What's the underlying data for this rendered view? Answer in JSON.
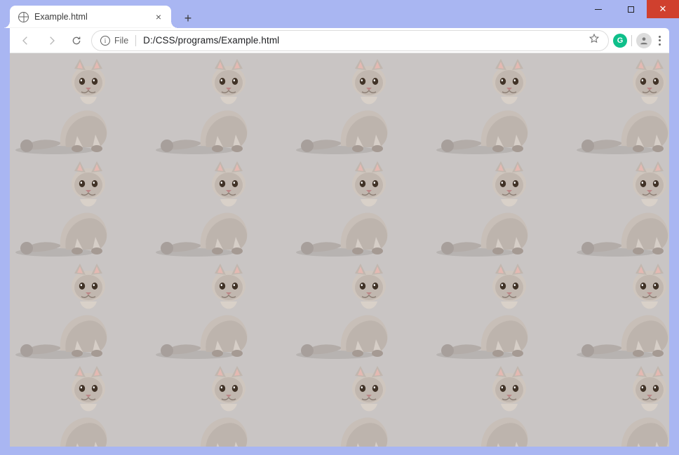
{
  "window": {
    "platform": "chrome-windows",
    "minimize_label": "Minimize",
    "maximize_label": "Maximize",
    "close_label": "Close"
  },
  "tab": {
    "title": "Example.html",
    "favicon": "globe-icon",
    "close_label": "Close tab",
    "new_tab_label": "New tab"
  },
  "toolbar": {
    "back_label": "Back",
    "forward_label": "Forward",
    "reload_label": "Reload",
    "file_chip": "File",
    "info_tooltip": "View site information",
    "url": "D:/CSS/programs/Example.html",
    "bookmark_label": "Bookmark",
    "extension_label": "Grammarly",
    "extension_glyph": "G",
    "profile_label": "Profile",
    "menu_label": "Menu"
  },
  "page": {
    "background_color": "#c9c5c4",
    "tile_size": "200px 146px",
    "tile_description": "Seated lilac British Shorthair cat facing viewer, tail curving to the left, on a neutral grey studio background; image repeats in a grid via CSS background-repeat: repeat.",
    "rows_visible": 4,
    "cols_visible": 5,
    "tile_svg": "<svg xmlns='http://www.w3.org/2000/svg' viewBox='0 0 200 146'><rect width='200' height='146' fill='%23c9c5c4'/><ellipse cx='64' cy='138' rx='56' ry='6' fill='%23b7b3b1'/><path d='M18 136 C 30 122, 58 120, 74 128 C 68 134, 40 140, 18 136 Z' fill='%23b3aca8'/><circle cx='24' cy='132' r='9' fill='%23a79f9b'/><path d='M72 132 C 70 106, 82 90, 98 84 C 118 76, 134 88, 138 106 C 140 118, 136 128, 128 134 Z' fill='%23c8bfb8'/><path d='M80 134 C 76 112, 90 94, 108 90 C 124 86, 136 98, 138 112 C 139 122, 134 130, 126 134 Z' fill='%23bdb4ad'/><path d='M92 134 L96 118 L104 134 Z' fill='%23d6cec7'/><path d='M118 134 L122 116 L130 134 Z' fill='%23d6cec7'/><ellipse cx='96' cy='136' rx='8' ry='5' fill='%23a59a93'/><ellipse cx='124' cy='136' rx='8' ry='5' fill='%23a59a93'/><ellipse cx='112' cy='40' rx='24' ry='22' fill='%23cfc6be'/><ellipse cx='112' cy='42' rx='20' ry='18' fill='%23c1b7af'/><path d='M92 22 L100 8 L108 24 Z' fill='%23c1b7af'/><path d='M96 21 L100 12 L104 22 Z' fill='%23e4b9b2'/><path d='M132 22 L124 8 L116 24 Z' fill='%23c1b7af'/><path d='M128 21 L124 12 L120 22 Z' fill='%23e4b9b2'/><ellipse cx='103' cy='40' rx='4.2' ry='5' fill='%23413327'/><ellipse cx='121' cy='40' rx='4.2' ry='5' fill='%23413327'/><ellipse cx='101.8' cy='38.6' rx='1.2' ry='1.5' fill='%23fff'/><ellipse cx='119.8' cy='38.6' rx='1.2' ry='1.5' fill='%23fff'/><path d='M108 49 L116 49 L112 53 Z' fill='%23b88'/><path d='M112 53 C 109 57, 105 57, 102 55' stroke='%238a7c72' stroke-width='1.4' fill='none'/><path d='M112 53 C 115 57, 119 57, 122 55' stroke='%238a7c72' stroke-width='1.4' fill='none'/><path d='M100 62 C 104 76, 120 76, 124 62' fill='%23d9d1c9'/></svg>"
  }
}
